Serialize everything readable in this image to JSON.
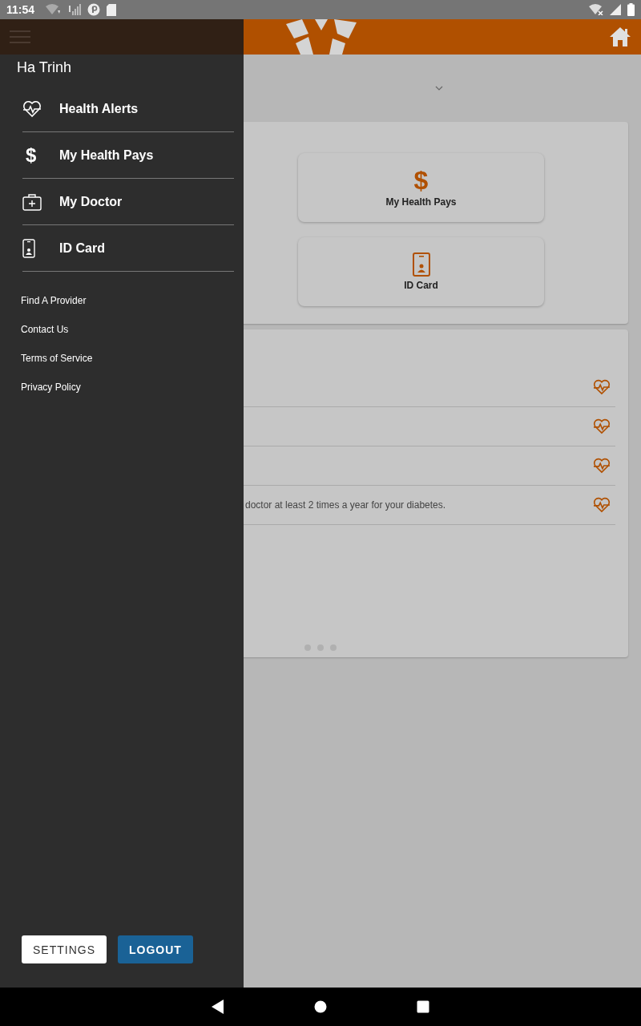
{
  "status_bar": {
    "time": "11:54"
  },
  "tiles": [
    {
      "label": "My Health Pays",
      "kind": "pays",
      "symbol": "$"
    },
    {
      "label": "ID Card",
      "kind": "idcard"
    }
  ],
  "alerts": {
    "items": [
      {
        "kind": "health"
      },
      {
        "kind": "health"
      },
      {
        "kind": "health"
      },
      {
        "kind": "health",
        "text": "doctor at least 2 times a year for your diabetes."
      }
    ]
  },
  "drawer": {
    "user_name": "Ha Trinh",
    "menu": [
      {
        "label": "Health Alerts",
        "kind": "alerts"
      },
      {
        "label": "My Health Pays",
        "kind": "pays",
        "symbol": "$"
      },
      {
        "label": "My Doctor",
        "kind": "doctor"
      },
      {
        "label": "ID Card",
        "kind": "idcard"
      }
    ],
    "links": [
      "Find A Provider",
      "Contact Us",
      "Terms of Service",
      "Privacy Policy"
    ],
    "buttons": [
      {
        "label": "SETTINGS",
        "kind": "secondary"
      },
      {
        "label": "LOGOUT",
        "kind": "primary"
      }
    ]
  }
}
